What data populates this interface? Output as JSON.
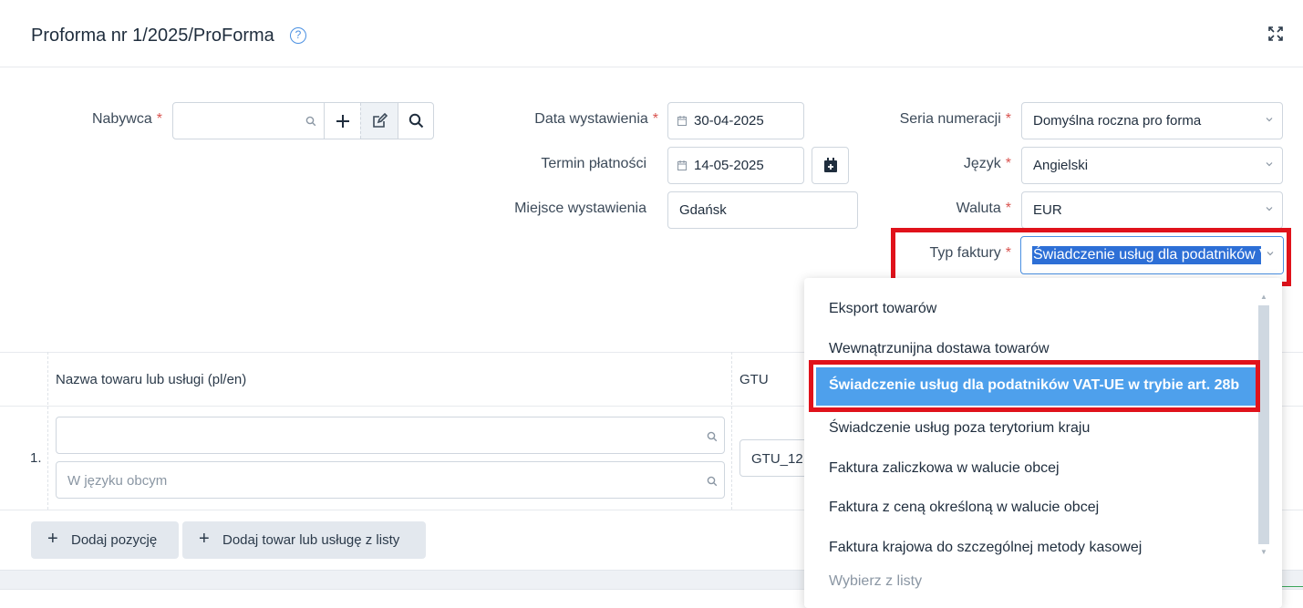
{
  "header": {
    "title": "Proforma nr 1/2025/ProForma",
    "help_icon": "question-circle-icon",
    "expand_icon": "expand-icon"
  },
  "buyer": {
    "label": "Nabywca",
    "required": "*",
    "value": ""
  },
  "issue_date": {
    "label": "Data wystawienia",
    "required": "*",
    "value": "30-04-2025"
  },
  "payment_term": {
    "label": "Termin płatności",
    "value": "14-05-2025"
  },
  "issue_place": {
    "label": "Miejsce wystawienia",
    "value": "Gdańsk"
  },
  "numbering": {
    "label": "Seria numeracji",
    "required": "*",
    "value": "Domyślna roczna pro forma"
  },
  "language": {
    "label": "Język",
    "required": "*",
    "value": "Angielski"
  },
  "currency": {
    "label": "Waluta",
    "required": "*",
    "value": "EUR"
  },
  "invoice_type": {
    "label": "Typ faktury",
    "required": "*",
    "value": "Świadczenie usług dla podatników VAT-UE w trybie art. 28b"
  },
  "table": {
    "col_name": "Nazwa towaru lub usługi (pl/en)",
    "col_gtu": "GTU",
    "rows": [
      {
        "num": "1.",
        "name": "",
        "foreign_placeholder": "W języku obcym",
        "gtu": "GTU_12"
      }
    ]
  },
  "buttons": {
    "add_position": "Dodaj pozycję",
    "add_from_list": "Dodaj towar lub usługę z listy"
  },
  "dropdown": {
    "options": [
      "Eksport towarów",
      "Wewnątrzunijna dostawa towarów",
      "Świadczenie usług dla podatników VAT-UE w trybie art. 28b",
      "Świadczenie usług poza terytorium kraju",
      "Faktura zaliczkowa w walucie obcej",
      "Faktura z ceną określoną w walucie obcej",
      "Faktura krajowa do szczególnej metody kasowej"
    ],
    "selected_index": 2,
    "placeholder": "Wybierz z listy"
  },
  "colors": {
    "accent": "#4ea0ec",
    "highlight": "#e0121b",
    "required": "#d9534f"
  }
}
